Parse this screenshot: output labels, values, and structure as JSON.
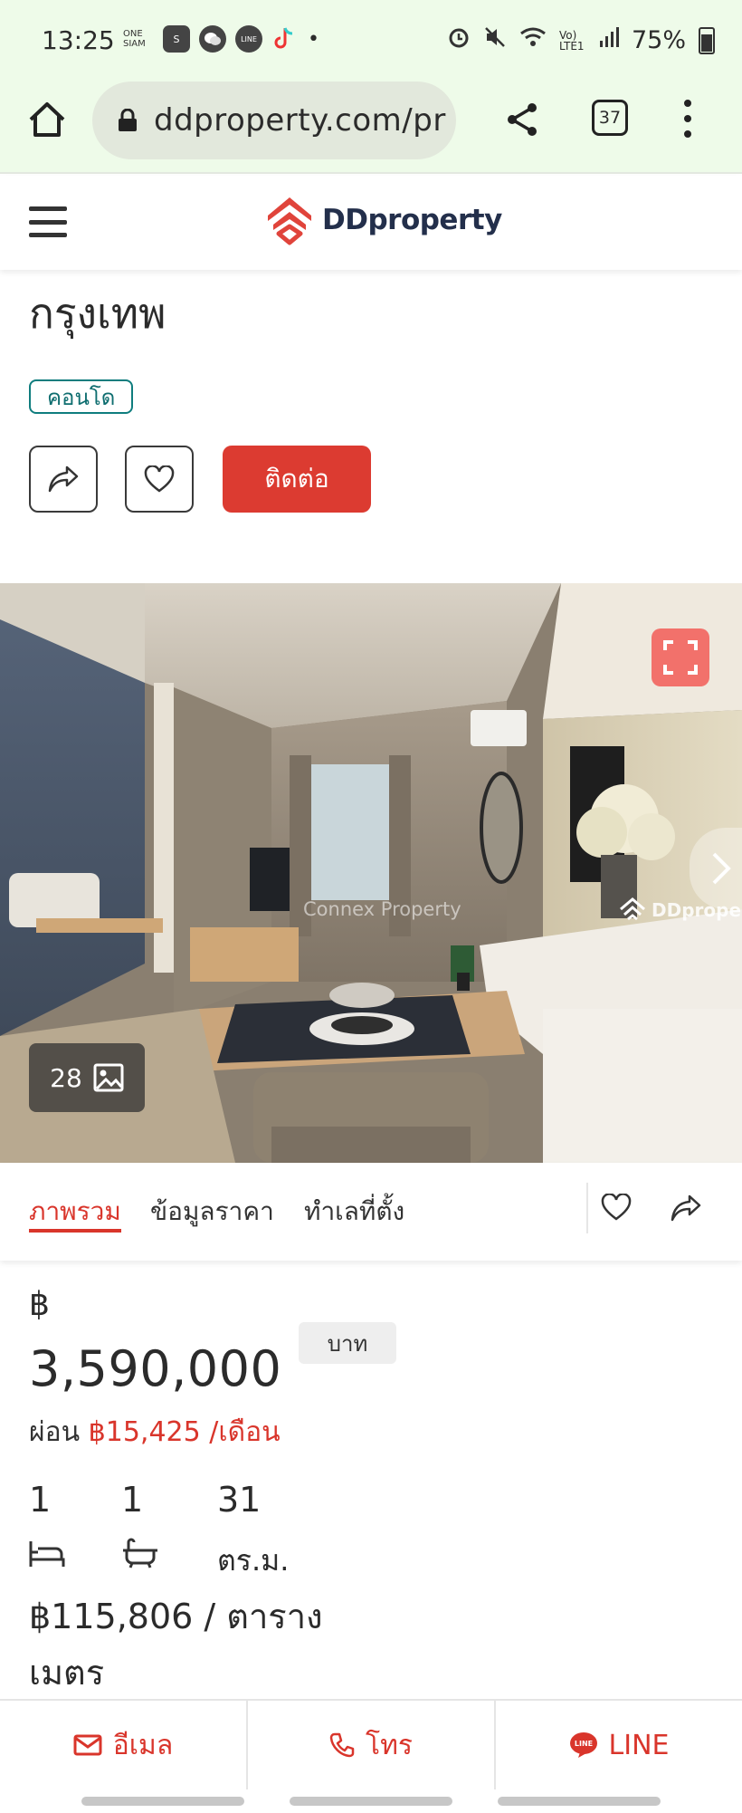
{
  "status_bar": {
    "time": "13:25",
    "app_icons": [
      "ONE SIAM",
      "S",
      "wechat",
      "LINE",
      "tiktok"
    ],
    "extra_dot": "•",
    "network": "Vo) LTE1",
    "battery": "75%"
  },
  "browser": {
    "url": "ddproperty.com/pr",
    "tab_count": "37"
  },
  "header": {
    "logo_text": "DDproperty"
  },
  "listing": {
    "title_partial": "กรุงเทพ",
    "type_badge": "คอนโด",
    "contact_label": "ติดต่อ",
    "photo_count": "28",
    "watermark_center": "Connex Property",
    "watermark_right": "DDproperty"
  },
  "tabs": [
    {
      "label": "ภาพรวม",
      "active": true
    },
    {
      "label": "ข้อมูลราคา",
      "active": false
    },
    {
      "label": "ทำเลที่ตั้ง",
      "active": false
    }
  ],
  "price": {
    "currency_symbol": "฿",
    "amount": "3,590,000",
    "unit_chip": "บาท",
    "installment_prefix": "ผ่อน",
    "installment_amount": "฿15,425 /เดือน"
  },
  "specs": {
    "bedrooms": "1",
    "bathrooms": "1",
    "area": "31",
    "area_unit": "ตร.ม.",
    "price_per_sqm": "฿115,806 / ตาราง เมตร"
  },
  "bottom_bar": {
    "email_label": "อีเมล",
    "call_label": "โทร",
    "line_label": "LINE"
  },
  "colors": {
    "brand_red": "#d9352b",
    "badge_teal": "#0f7d7e",
    "chrome_bg": "#eefbe9"
  }
}
